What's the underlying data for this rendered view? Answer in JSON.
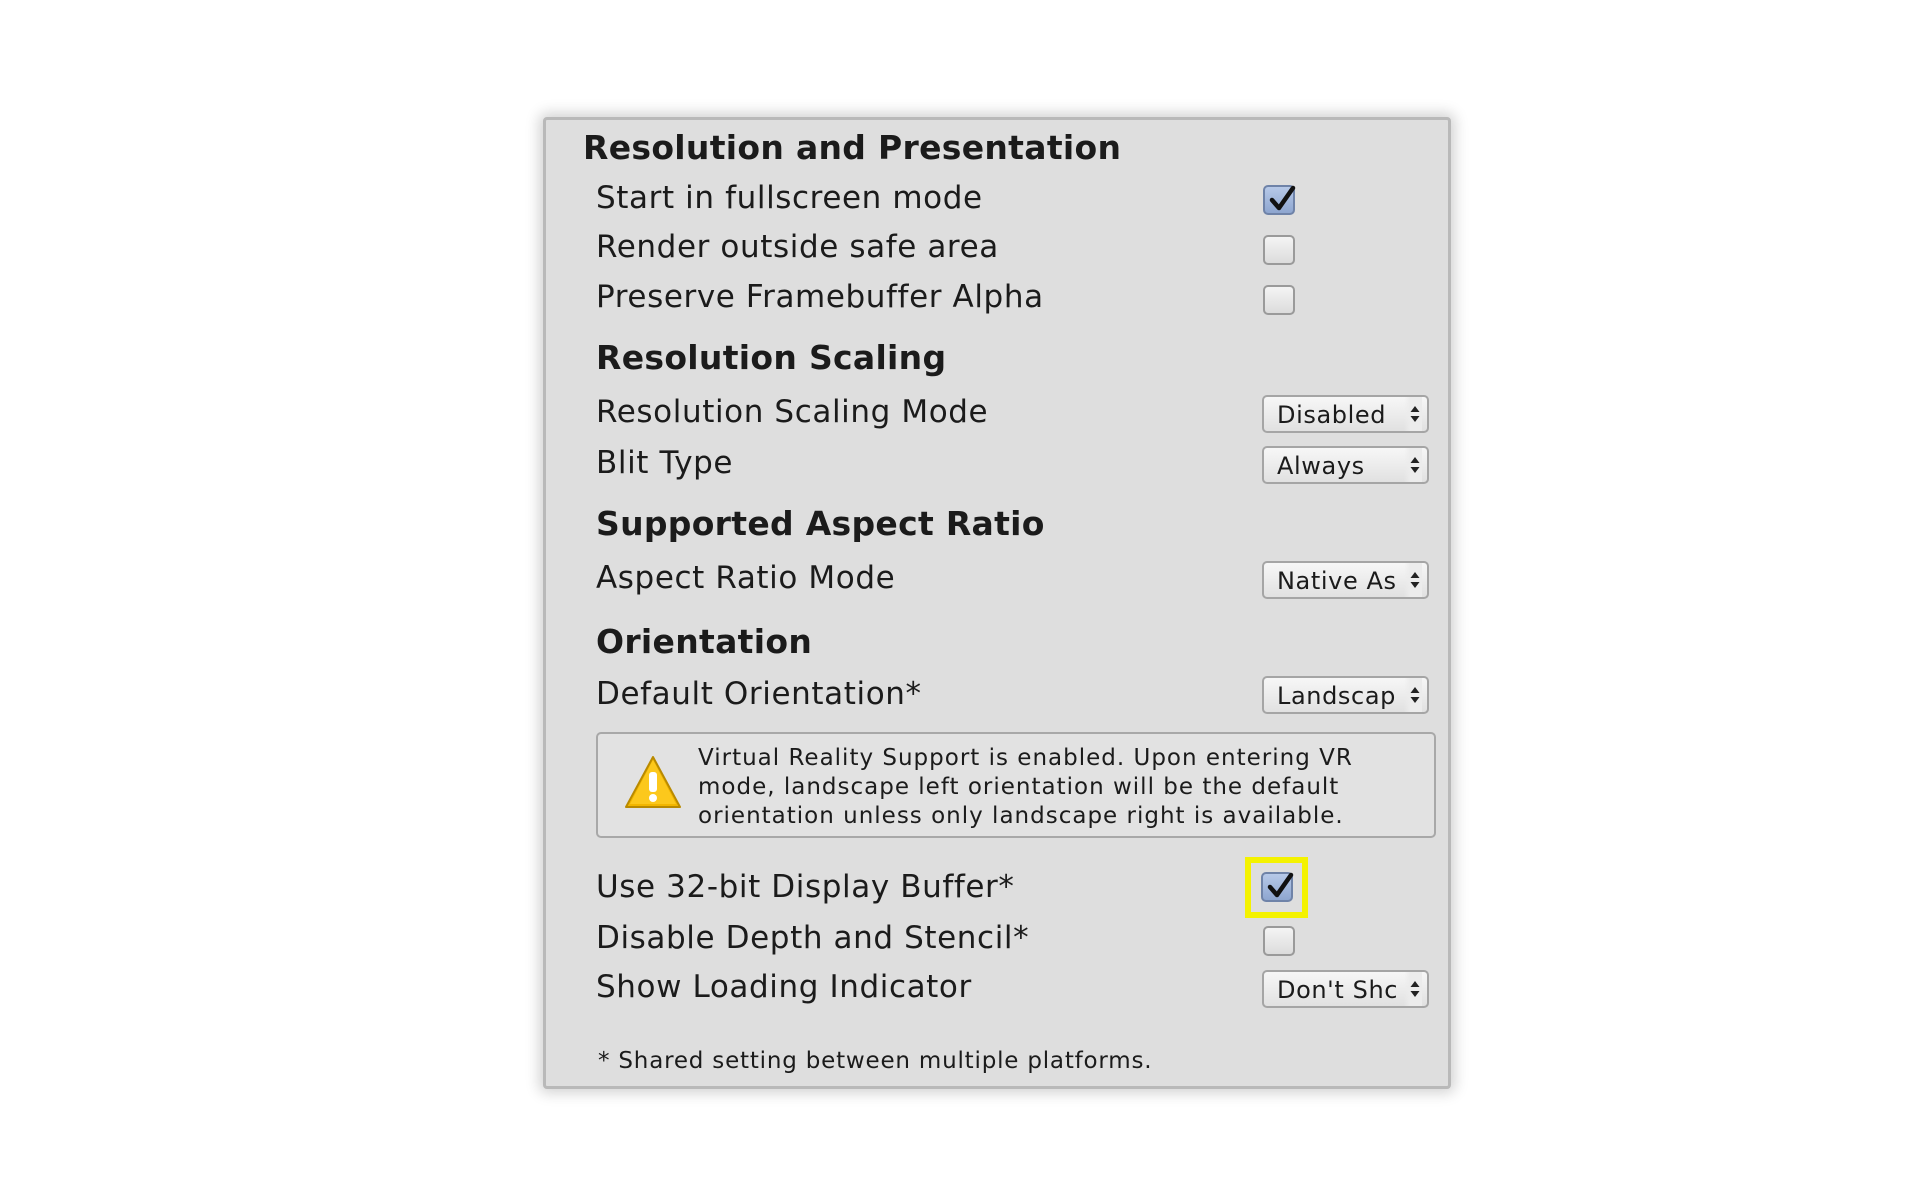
{
  "section_resolution_presentation": {
    "title": "Resolution and Presentation",
    "rows": [
      {
        "label": "Start in fullscreen mode",
        "checked": true
      },
      {
        "label": "Render outside safe area",
        "checked": false
      },
      {
        "label": "Preserve Framebuffer Alpha",
        "checked": false
      }
    ]
  },
  "section_resolution_scaling": {
    "title": "Resolution Scaling",
    "rows": [
      {
        "label": "Resolution Scaling Mode",
        "value": "Disabled"
      },
      {
        "label": "Blit Type",
        "value": "Always"
      }
    ]
  },
  "section_aspect_ratio": {
    "title": "Supported Aspect Ratio",
    "rows": [
      {
        "label": "Aspect Ratio Mode",
        "value": "Native As"
      }
    ]
  },
  "section_orientation": {
    "title": "Orientation",
    "rows": [
      {
        "label": "Default Orientation*",
        "value": "Landscap"
      }
    ]
  },
  "warning": {
    "lines": [
      "Virtual Reality Support is enabled. Upon entering VR",
      "mode, landscape left orientation will be the default",
      "orientation unless only landscape right is available."
    ]
  },
  "other_rows": [
    {
      "label": "Use 32-bit Display Buffer*",
      "checked": true,
      "highlighted": true
    },
    {
      "label": "Disable Depth and Stencil*",
      "checked": false
    },
    {
      "label": "Show Loading Indicator",
      "value": "Don't Shc"
    }
  ],
  "footnote": "* Shared setting between multiple platforms.",
  "colors": {
    "panel_bg": "#dedede",
    "highlight": "#f4f200",
    "checkbox_checked": "#8ea6d0",
    "warning_icon": "#f2b600"
  }
}
